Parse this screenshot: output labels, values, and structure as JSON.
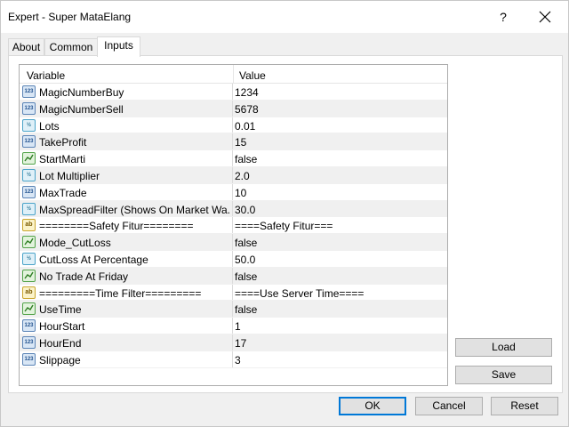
{
  "window": {
    "title": "Expert - Super MataElang",
    "help_label": "?"
  },
  "tabs": [
    {
      "label": "About"
    },
    {
      "label": "Common"
    },
    {
      "label": "Inputs"
    }
  ],
  "grid": {
    "header": {
      "variable": "Variable",
      "value": "Value"
    },
    "rows": [
      {
        "type": "int",
        "icon": "integer-icon",
        "name": "MagicNumberBuy",
        "value": "1234"
      },
      {
        "type": "int",
        "icon": "integer-icon",
        "name": "MagicNumberSell",
        "value": "5678"
      },
      {
        "type": "dbl",
        "icon": "double-icon",
        "name": "Lots",
        "value": "0.01"
      },
      {
        "type": "int",
        "icon": "integer-icon",
        "name": "TakeProfit",
        "value": "15"
      },
      {
        "type": "bool",
        "icon": "boolean-icon",
        "name": "StartMarti",
        "value": "false"
      },
      {
        "type": "dbl",
        "icon": "double-icon",
        "name": "Lot Multiplier",
        "value": "2.0"
      },
      {
        "type": "int",
        "icon": "integer-icon",
        "name": "MaxTrade",
        "value": "10"
      },
      {
        "type": "dbl",
        "icon": "double-icon",
        "name": "MaxSpreadFilter (Shows On  Market Wa...",
        "value": "30.0"
      },
      {
        "type": "str",
        "icon": "string-icon",
        "name": "========Safety Fitur========",
        "value": "====Safety Fitur==="
      },
      {
        "type": "bool",
        "icon": "boolean-icon",
        "name": "Mode_CutLoss",
        "value": "false"
      },
      {
        "type": "dbl",
        "icon": "double-icon",
        "name": "CutLoss At Percentage",
        "value": "50.0"
      },
      {
        "type": "bool",
        "icon": "boolean-icon",
        "name": "No Trade At Friday",
        "value": "false"
      },
      {
        "type": "str",
        "icon": "string-icon",
        "name": "=========Time Filter=========",
        "value": "====Use Server Time===="
      },
      {
        "type": "bool",
        "icon": "boolean-icon",
        "name": "UseTime",
        "value": "false"
      },
      {
        "type": "int",
        "icon": "integer-icon",
        "name": "HourStart",
        "value": "1"
      },
      {
        "type": "int",
        "icon": "integer-icon",
        "name": "HourEnd",
        "value": "17"
      },
      {
        "type": "int",
        "icon": "integer-icon",
        "name": "Slippage",
        "value": "3"
      }
    ]
  },
  "side_buttons": {
    "load": "Load",
    "save": "Save"
  },
  "bottom_buttons": {
    "ok": "OK",
    "cancel": "Cancel",
    "reset": "Reset"
  },
  "colors": {
    "accent": "#0078d7"
  }
}
